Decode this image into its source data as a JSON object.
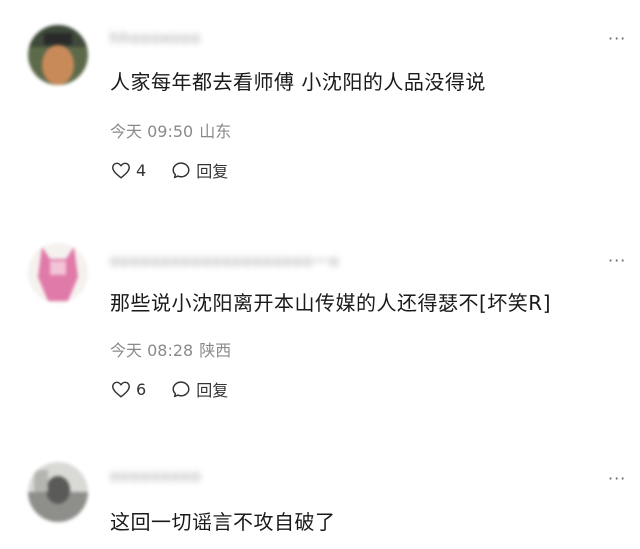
{
  "comments": [
    {
      "username": "hhoooxooo",
      "text": "人家每年都去看师傅 小沈阳的人品没得说",
      "time": "今天 09:50",
      "location": "山东",
      "likes": "4",
      "reply_label": "回复",
      "more_icon": "···"
    },
    {
      "username": "oooooooooooooooooooo一o",
      "text": "那些说小沈阳离开本山传媒的人还得瑟不[坏笑R]",
      "time": "今天 08:28",
      "location": "陕西",
      "likes": "6",
      "reply_label": "回复",
      "more_icon": "···"
    },
    {
      "username": "ooooooooo",
      "text": "这回一切谣言不攻自破了",
      "more_icon": "···"
    }
  ]
}
